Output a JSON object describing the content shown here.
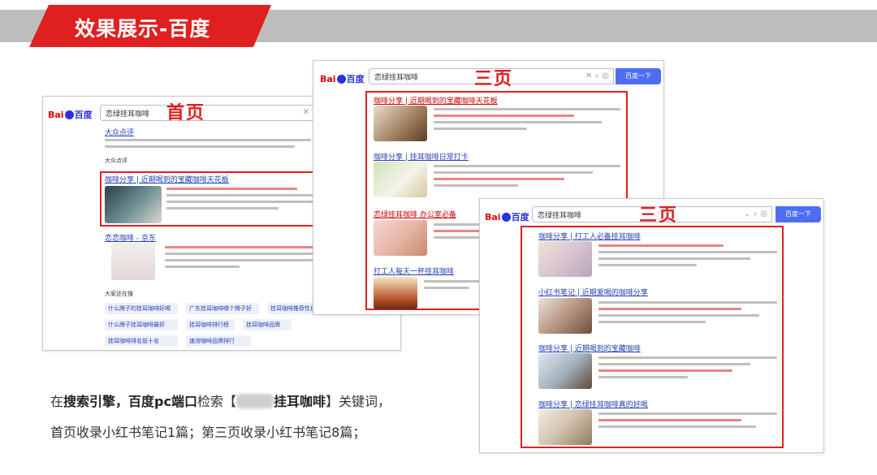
{
  "header": {
    "title": "效果展示-百度",
    "band_color": "#bdbdbd",
    "tag_color": "#e02020"
  },
  "logo": {
    "bai": "Bai",
    "du": "百度"
  },
  "shots": {
    "first": {
      "page_label": "首页",
      "query": "恋绿挂耳咖啡",
      "results": [
        {
          "title": "大众点评"
        },
        {
          "title": "咖啡分享 | 近期喝到的宝藏咖啡天花板"
        },
        {
          "title": "恋恋咖啡 - 京东"
        }
      ],
      "related_heading": "大家还在搜",
      "related": [
        "什么牌子的挂耳咖啡好喝",
        "广东挂耳咖啡哪个牌子好",
        "挂耳咖啡推荐性价比高",
        "什么牌子挂耳咖啡最好",
        "挂耳咖啡排行榜",
        "挂耳咖啡品牌",
        "挂耳咖啡排名前十名",
        "速溶咖啡品牌排行"
      ]
    },
    "third_a": {
      "page_label": "三页",
      "query": "恋绿挂耳咖啡",
      "button": "百度一下",
      "results": [
        {
          "title": "咖啡分享 | 近期喝到的宝藏咖啡天花板"
        },
        {
          "title": "咖啡分享 | 挂耳咖啡日常打卡"
        },
        {
          "title": "恋绿挂耳咖啡 办公室必备"
        },
        {
          "title": "打工人每天一杯挂耳咖啡"
        }
      ]
    },
    "third_b": {
      "page_label": "三页",
      "query": "恋绿挂耳咖啡",
      "button": "百度一下",
      "results": [
        {
          "title": "咖啡分享 | 打工人必备挂耳咖啡"
        },
        {
          "title": "小红书笔记 | 近期爱喝的咖啡分享"
        },
        {
          "title": "咖啡分享 | 近期喝到的宝藏咖啡"
        },
        {
          "title": "咖啡分享 | 恋绿挂耳咖啡真的好喝"
        }
      ]
    }
  },
  "caption": {
    "line1_pre": "在",
    "line1_b1": "搜索引擎，百度pc端口",
    "line1_mid": "检索【",
    "line1_b2": "挂耳咖啡",
    "line1_post": "】关键词，",
    "line2": "首页收录小红书笔记1篇；第三页收录小红书笔记8篇；"
  }
}
